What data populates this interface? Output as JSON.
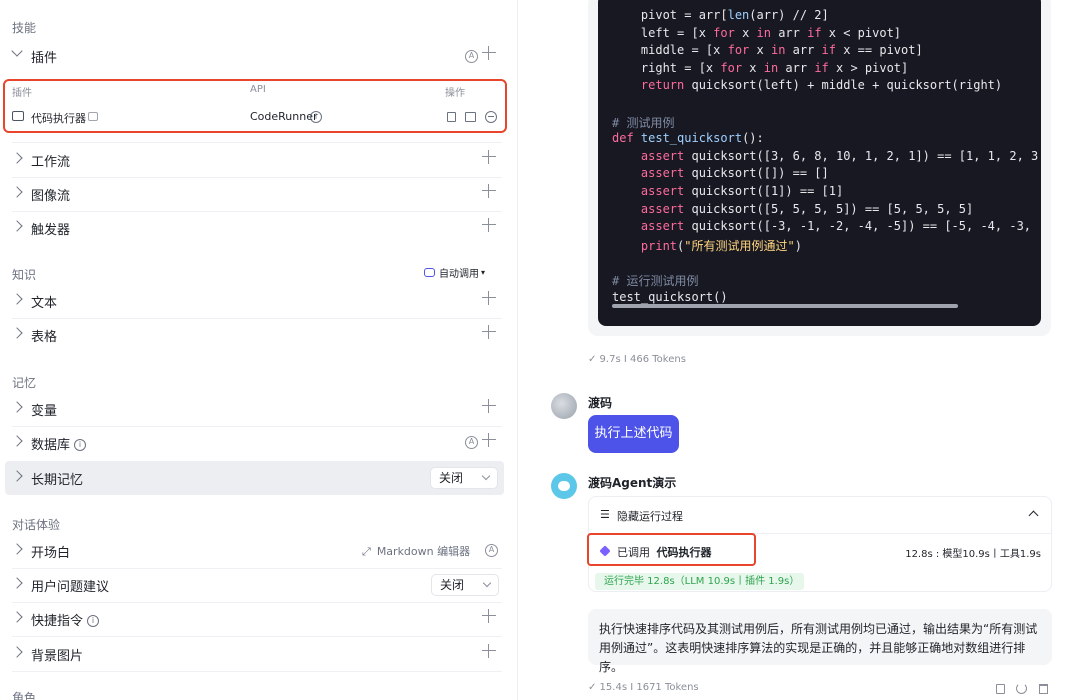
{
  "left": {
    "skills_title": "技能",
    "plugins": {
      "label": "插件",
      "auto_icon": "A",
      "columns": [
        "插件",
        "API",
        "操作"
      ],
      "row": {
        "name": "代码执行器",
        "api": "CodeRunner"
      }
    },
    "workflow": "工作流",
    "imageflow": "图像流",
    "trigger": "触发器",
    "knowledge_title": "知识",
    "auto_call": "自动调用",
    "text": "文本",
    "table": "表格",
    "memory_title": "记忆",
    "variable": "变量",
    "database": "数据库",
    "longterm": "长期记忆",
    "longterm_value": "关闭",
    "dialog_title": "对话体验",
    "opening": "开场白",
    "markdown_editor": "Markdown 编辑器",
    "suggestions": "用户问题建议",
    "suggestions_value": "关闭",
    "shortcuts": "快捷指令",
    "background": "背景图片",
    "role_title": "角色"
  },
  "right": {
    "code_lines": [
      [
        {
          "t": "    pivot = arr[",
          "c": ""
        },
        {
          "t": "len",
          "c": "fn"
        },
        {
          "t": "(arr) // 2]",
          "c": ""
        }
      ],
      [
        {
          "t": "    left = [x ",
          "c": ""
        },
        {
          "t": "for",
          "c": "kw"
        },
        {
          "t": " x ",
          "c": ""
        },
        {
          "t": "in",
          "c": "kw"
        },
        {
          "t": " arr ",
          "c": ""
        },
        {
          "t": "if",
          "c": "kw"
        },
        {
          "t": " x < pivot]",
          "c": ""
        }
      ],
      [
        {
          "t": "    middle = [x ",
          "c": ""
        },
        {
          "t": "for",
          "c": "kw"
        },
        {
          "t": " x ",
          "c": ""
        },
        {
          "t": "in",
          "c": "kw"
        },
        {
          "t": " arr ",
          "c": ""
        },
        {
          "t": "if",
          "c": "kw"
        },
        {
          "t": " x == pivot]",
          "c": ""
        }
      ],
      [
        {
          "t": "    right = [x ",
          "c": ""
        },
        {
          "t": "for",
          "c": "kw"
        },
        {
          "t": " x ",
          "c": ""
        },
        {
          "t": "in",
          "c": "kw"
        },
        {
          "t": " arr ",
          "c": ""
        },
        {
          "t": "if",
          "c": "kw"
        },
        {
          "t": " x > pivot]",
          "c": ""
        }
      ],
      [
        {
          "t": "    return",
          "c": "kw"
        },
        {
          "t": " quicksort(left) + middle + quicksort(right)",
          "c": ""
        }
      ],
      [
        {
          "t": "",
          "c": ""
        }
      ],
      [
        {
          "t": "# 测试用例",
          "c": "cm"
        }
      ],
      [
        {
          "t": "def",
          "c": "kw"
        },
        {
          "t": " test_quicksort",
          "c": "fn"
        },
        {
          "t": "():",
          "c": ""
        }
      ],
      [
        {
          "t": "    assert",
          "c": "kw"
        },
        {
          "t": " quicksort([3, 6, 8, 10, 1, 2, 1]) == [1, 1, 2, 3",
          "c": ""
        }
      ],
      [
        {
          "t": "    assert",
          "c": "kw"
        },
        {
          "t": " quicksort([]) == []",
          "c": ""
        }
      ],
      [
        {
          "t": "    assert",
          "c": "kw"
        },
        {
          "t": " quicksort([1]) == [1]",
          "c": ""
        }
      ],
      [
        {
          "t": "    assert",
          "c": "kw"
        },
        {
          "t": " quicksort([5, 5, 5, 5]) == [5, 5, 5, 5]",
          "c": ""
        }
      ],
      [
        {
          "t": "    assert",
          "c": "kw"
        },
        {
          "t": " quicksort([-3, -1, -2, -4, -5]) == [-5, -4, -3,",
          "c": ""
        }
      ],
      [
        {
          "t": "    print",
          "c": "kw"
        },
        {
          "t": "(",
          "c": ""
        },
        {
          "t": "\"所有测试用例通过\"",
          "c": "str"
        },
        {
          "t": ")",
          "c": ""
        }
      ],
      [
        {
          "t": "",
          "c": ""
        }
      ],
      [
        {
          "t": "# 运行测试用例",
          "c": "cm"
        }
      ],
      [
        {
          "t": "test_quicksort()",
          "c": ""
        }
      ]
    ],
    "meta1": "✓ 9.7s  I  466 Tokens",
    "user_name": "渡码",
    "user_msg": "执行上述代码",
    "bot_name": "渡码Agent演示",
    "hide_process": "隐藏运行过程",
    "called_prefix": "已调用",
    "called_tool": "代码执行器",
    "timing": "12.8s : 模型10.9s丨工具1.9s",
    "done": "运行完毕 12.8s（LLM 10.9s丨插件 1.9s）",
    "answer": "执行快速排序代码及其测试用例后，所有测试用例均已通过，输出结果为“所有测试用例通过”。这表明快速排序算法的实现是正确的，并且能够正确地对数组进行排序。",
    "meta2": "✓ 15.4s  I  1671 Tokens"
  },
  "colors": {
    "accent": "#4d53e8",
    "highlight": "#e8452c",
    "code_bg": "#171821"
  }
}
